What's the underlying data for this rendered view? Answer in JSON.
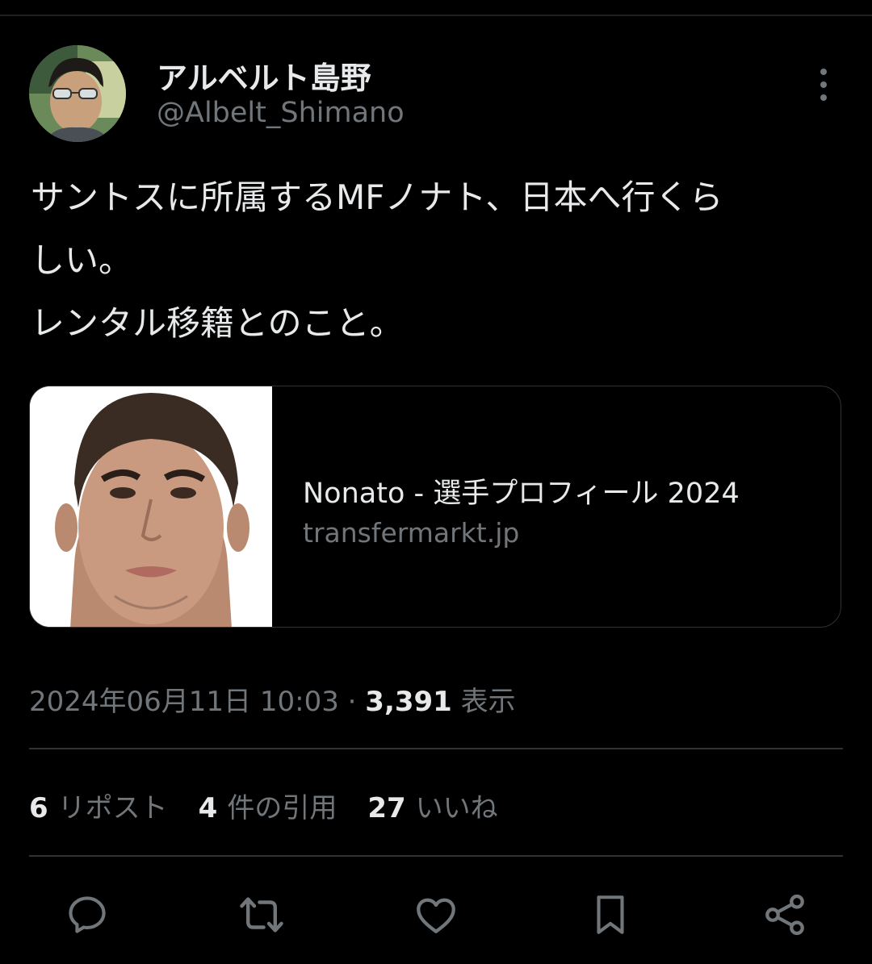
{
  "author": {
    "name": "アルベルト島野",
    "handle": "@Albelt_Shimano",
    "avatar": "avatar-photo"
  },
  "tweet": {
    "lines": [
      "サントスに所属するMFノナト、日本へ行くら",
      "しい。",
      "レンタル移籍とのこと。"
    ]
  },
  "card": {
    "title": "Nonato - 選手プロフィール 2024",
    "domain": "transfermarkt.jp",
    "image": "player-photo"
  },
  "meta": {
    "timestamp": "2024年06月11日 10:03",
    "separator": "·",
    "views_count": "3,391",
    "views_label": "表示"
  },
  "stats": [
    {
      "count": "6",
      "label": "リポスト"
    },
    {
      "count": "4",
      "label": "件の引用"
    },
    {
      "count": "27",
      "label": "いいね"
    }
  ],
  "actions": [
    "reply-icon",
    "retweet-icon",
    "like-icon",
    "bookmark-icon",
    "share-icon"
  ],
  "colors": {
    "background": "#000000",
    "text": "#e7e9ea",
    "secondary": "#71767b",
    "border": "#2f3336"
  }
}
